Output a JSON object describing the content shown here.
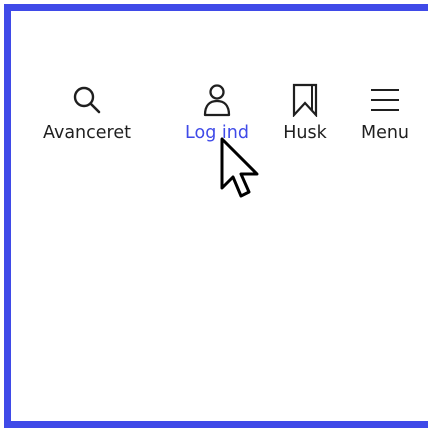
{
  "nav": {
    "items": [
      {
        "label": "Avanceret",
        "icon": "search-icon"
      },
      {
        "label": "Log ind",
        "icon": "user-icon"
      },
      {
        "label": "Husk",
        "icon": "bookmark-icon"
      },
      {
        "label": "Menu",
        "icon": "hamburger-menu-icon"
      }
    ],
    "active_index": 1
  },
  "colors": {
    "accent": "#3f4ae8",
    "text": "#1f1f1f",
    "background": "#ffffff"
  }
}
